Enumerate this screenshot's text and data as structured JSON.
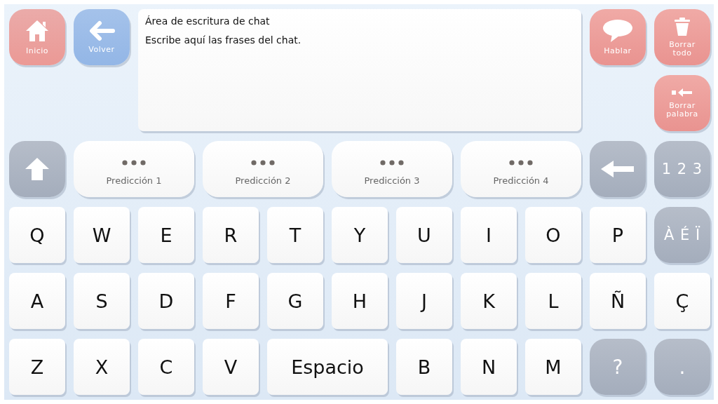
{
  "nav_buttons": [
    {
      "label": "Inicio",
      "kind": "home",
      "color": "#eb9995"
    },
    {
      "label": "Volver",
      "kind": "back",
      "color": "#93b6e6"
    }
  ],
  "chat_area": {
    "lines": [
      "Área de escritura de chat",
      "Escribe aquí las frases del chat."
    ]
  },
  "action_rows": [
    [
      {
        "label": "Hablar",
        "kind": "speak"
      },
      {
        "label": "Borrar todo",
        "kind": "clear"
      }
    ],
    [
      {
        "label": "Borrar palabra",
        "kind": "delete"
      }
    ]
  ],
  "prediction_row": [
    {
      "kind": "shift"
    },
    {
      "kind": "prediction",
      "label": "Predicción 1"
    },
    {
      "kind": "prediction",
      "label": "Predicción 2"
    },
    {
      "kind": "prediction",
      "label": "Predicción 3"
    },
    {
      "kind": "prediction",
      "label": "Predicción 4"
    },
    {
      "kind": "backspace"
    },
    {
      "kind": "mode",
      "label": "1 2 3"
    }
  ],
  "keyboard_rows": [
    [
      {
        "kind": "letter",
        "label": "Q"
      },
      {
        "kind": "letter",
        "label": "W"
      },
      {
        "kind": "letter",
        "label": "E"
      },
      {
        "kind": "letter",
        "label": "R"
      },
      {
        "kind": "letter",
        "label": "T"
      },
      {
        "kind": "letter",
        "label": "Y"
      },
      {
        "kind": "letter",
        "label": "U"
      },
      {
        "kind": "letter",
        "label": "I"
      },
      {
        "kind": "letter",
        "label": "O"
      },
      {
        "kind": "letter",
        "label": "P"
      },
      {
        "kind": "mode",
        "label": "À É Ï"
      }
    ],
    [
      {
        "kind": "letter",
        "label": "A"
      },
      {
        "kind": "letter",
        "label": "S"
      },
      {
        "kind": "letter",
        "label": "D"
      },
      {
        "kind": "letter",
        "label": "F"
      },
      {
        "kind": "letter",
        "label": "G"
      },
      {
        "kind": "letter",
        "label": "H"
      },
      {
        "kind": "letter",
        "label": "J"
      },
      {
        "kind": "letter",
        "label": "K"
      },
      {
        "kind": "letter",
        "label": "L"
      },
      {
        "kind": "letter",
        "label": "Ñ"
      },
      {
        "kind": "letter",
        "label": "Ç"
      }
    ],
    [
      {
        "kind": "letter",
        "label": "Z"
      },
      {
        "kind": "letter",
        "label": "X"
      },
      {
        "kind": "letter",
        "label": "C"
      },
      {
        "kind": "letter",
        "label": "V"
      },
      {
        "kind": "space",
        "label": "Espacio"
      },
      {
        "kind": "letter",
        "label": "B"
      },
      {
        "kind": "letter",
        "label": "N"
      },
      {
        "kind": "letter",
        "label": "M"
      },
      {
        "kind": "symbol",
        "label": "?"
      },
      {
        "kind": "symbol",
        "label": "."
      }
    ]
  ]
}
